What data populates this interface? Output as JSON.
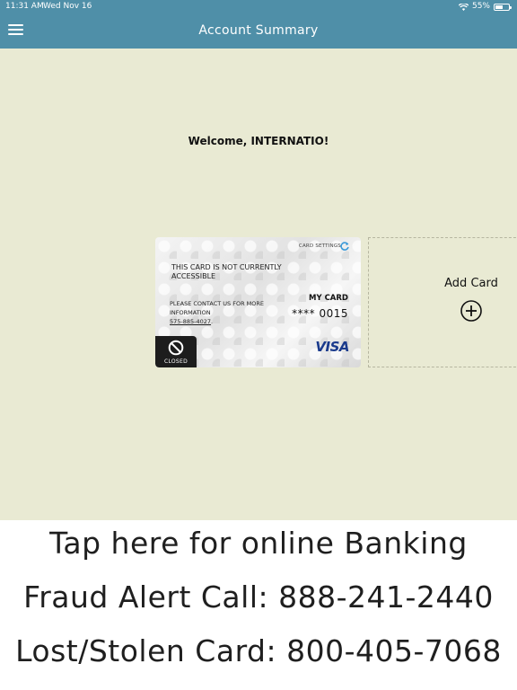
{
  "status_bar": {
    "time": "11:31 AM",
    "date": "Wed Nov 16",
    "battery_text": "55%",
    "battery_level": 0.55,
    "wifi_icon": "wifi-icon",
    "battery_icon": "battery-icon"
  },
  "nav": {
    "title": "Account Summary",
    "menu_icon": "hamburger-menu-icon"
  },
  "welcome": "Welcome, INTERNATIO!",
  "card": {
    "settings_label": "CARD SETTINGS",
    "status_line": "THIS CARD IS NOT CURRENTLY ACCESSIBLE",
    "contact_line": "PLEASE CONTACT US FOR MORE INFORMATION",
    "contact_phone": "575-885-4027",
    "contact_suffix": ".",
    "name": "MY CARD",
    "number": "**** 0015",
    "badge_label": "CLOSED",
    "brand": "VISA"
  },
  "add_card": {
    "label": "Add Card"
  },
  "banner": {
    "line1": "Tap here for online Banking",
    "line2": "Fraud Alert Call: 888-241-2440",
    "line3": "Lost/Stolen Card: 800-405-7068"
  },
  "colors": {
    "header": "#4f8fa8",
    "background": "#e9ead3",
    "visa_blue": "#1a3a8c",
    "refresh_blue": "#3a9ad9"
  }
}
